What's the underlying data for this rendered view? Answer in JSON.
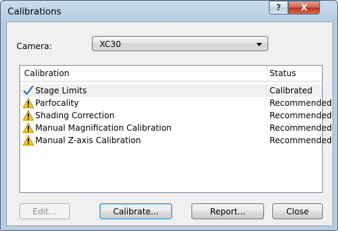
{
  "window": {
    "title": "Calibrations"
  },
  "titlebar": {
    "help_glyph": "?",
    "close_glyph": "X"
  },
  "camera": {
    "label": "Camera:",
    "selected": "XC30"
  },
  "list": {
    "columns": {
      "calibration": "Calibration",
      "status": "Status"
    },
    "rows": [
      {
        "name": "Stage Limits",
        "status": "Calibrated",
        "icon": "checkmark-icon"
      },
      {
        "name": "Parfocality",
        "status": "Recommended",
        "icon": "warning-icon"
      },
      {
        "name": "Shading Correction",
        "status": "Recommended",
        "icon": "warning-icon"
      },
      {
        "name": "Manual Magnification Calibration",
        "status": "Recommended",
        "icon": "warning-icon"
      },
      {
        "name": "Manual Z-axis Calibration",
        "status": "Recommended",
        "icon": "warning-icon"
      }
    ]
  },
  "buttons": {
    "edit": "Edit...",
    "calibrate": "Calibrate...",
    "report": "Report...",
    "close": "Close"
  },
  "colors": {
    "titlebar": "#b7cde4",
    "check": "#2a6fc8",
    "warning": "#f2cc16",
    "close_button": "#c9442a"
  }
}
